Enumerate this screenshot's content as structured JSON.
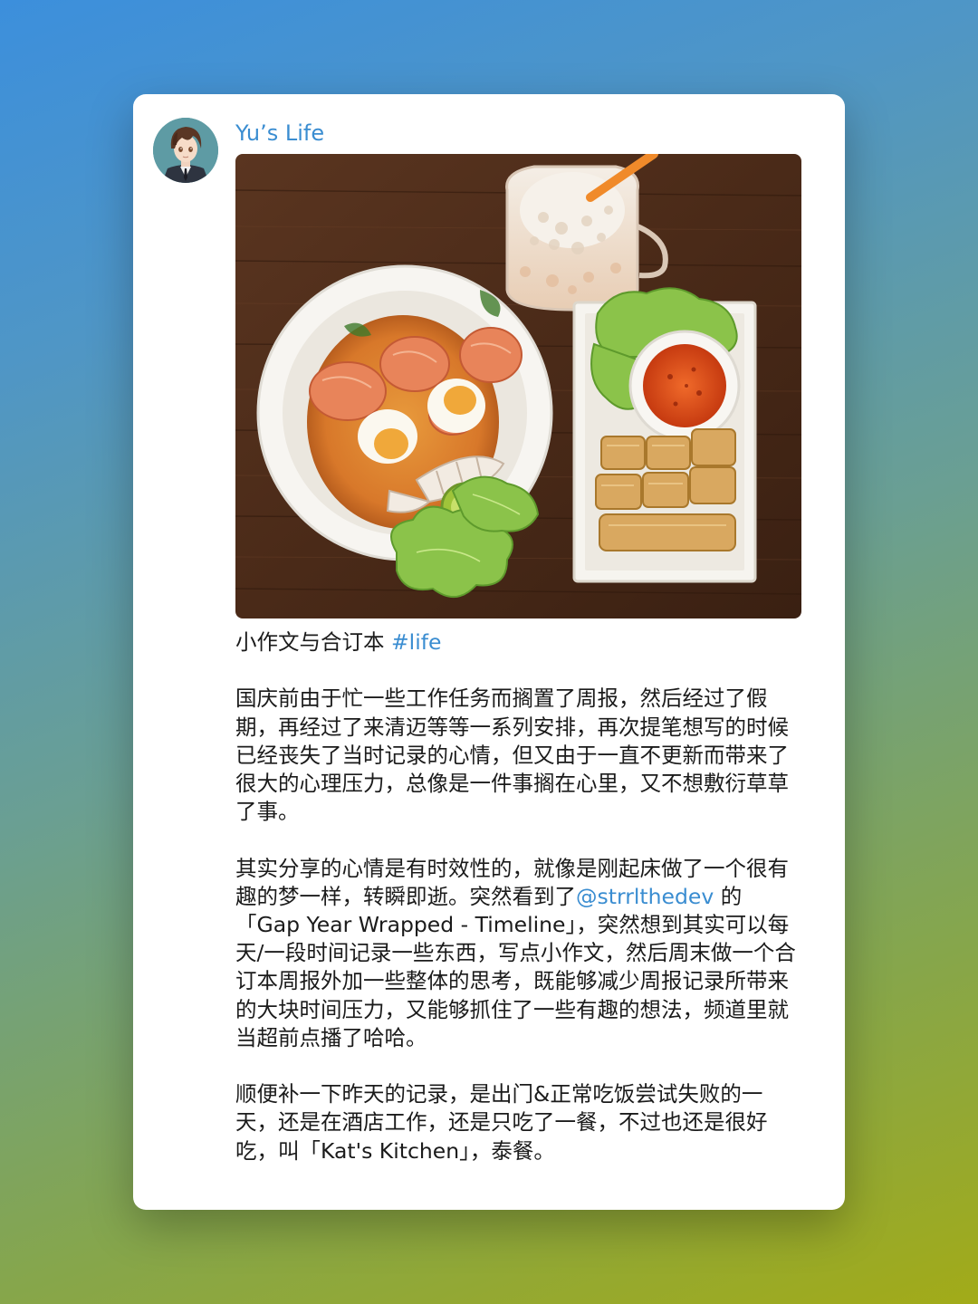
{
  "channel": {
    "name": "Yu’s Life"
  },
  "post": {
    "title_text": "小作文与合订本",
    "hashtag": "#life",
    "paragraph_1": "国庆前由于忙一些工作任务而搁置了周报，然后经过了假期，再经过了来清迈等等一系列安排，再次提笔想写的时候已经丧失了当时记录的心情，但又由于一直不更新而带来了很大的心理压力，总像是一件事搁在心里，又不想敷衍草草了事。",
    "paragraph_2_before": "其实分享的心情是有时效性的，就像是刚起床做了一个很有趣的梦一样，转瞬即逝。突然看到了",
    "mention": "@strrlthedev",
    "paragraph_2_after": " 的「Gap Year Wrapped - Timeline」，突然想到其实可以每天/一段时间记录一些东西，写点小作文，然后周末做一个合订本周报外加一些整体的思考，既能够减少周报记录所带来的大块时间压力，又能够抓住了一些有趣的想法，频道里就当超前点播了哈哈。",
    "paragraph_3": "顺便补一下昨天的记录，是出门&正常吃饭尝试失败的一天，还是在酒店工作，还是只吃了一餐，不过也还是很好吃，叫「Kat's Kitchen」，泰餐。"
  },
  "colors": {
    "link": "#3a8dd1",
    "text": "#1b1b1b",
    "card": "#ffffff"
  },
  "icons": {
    "avatar": "anime-boy-avatar",
    "photo": "thai-food-photo"
  }
}
